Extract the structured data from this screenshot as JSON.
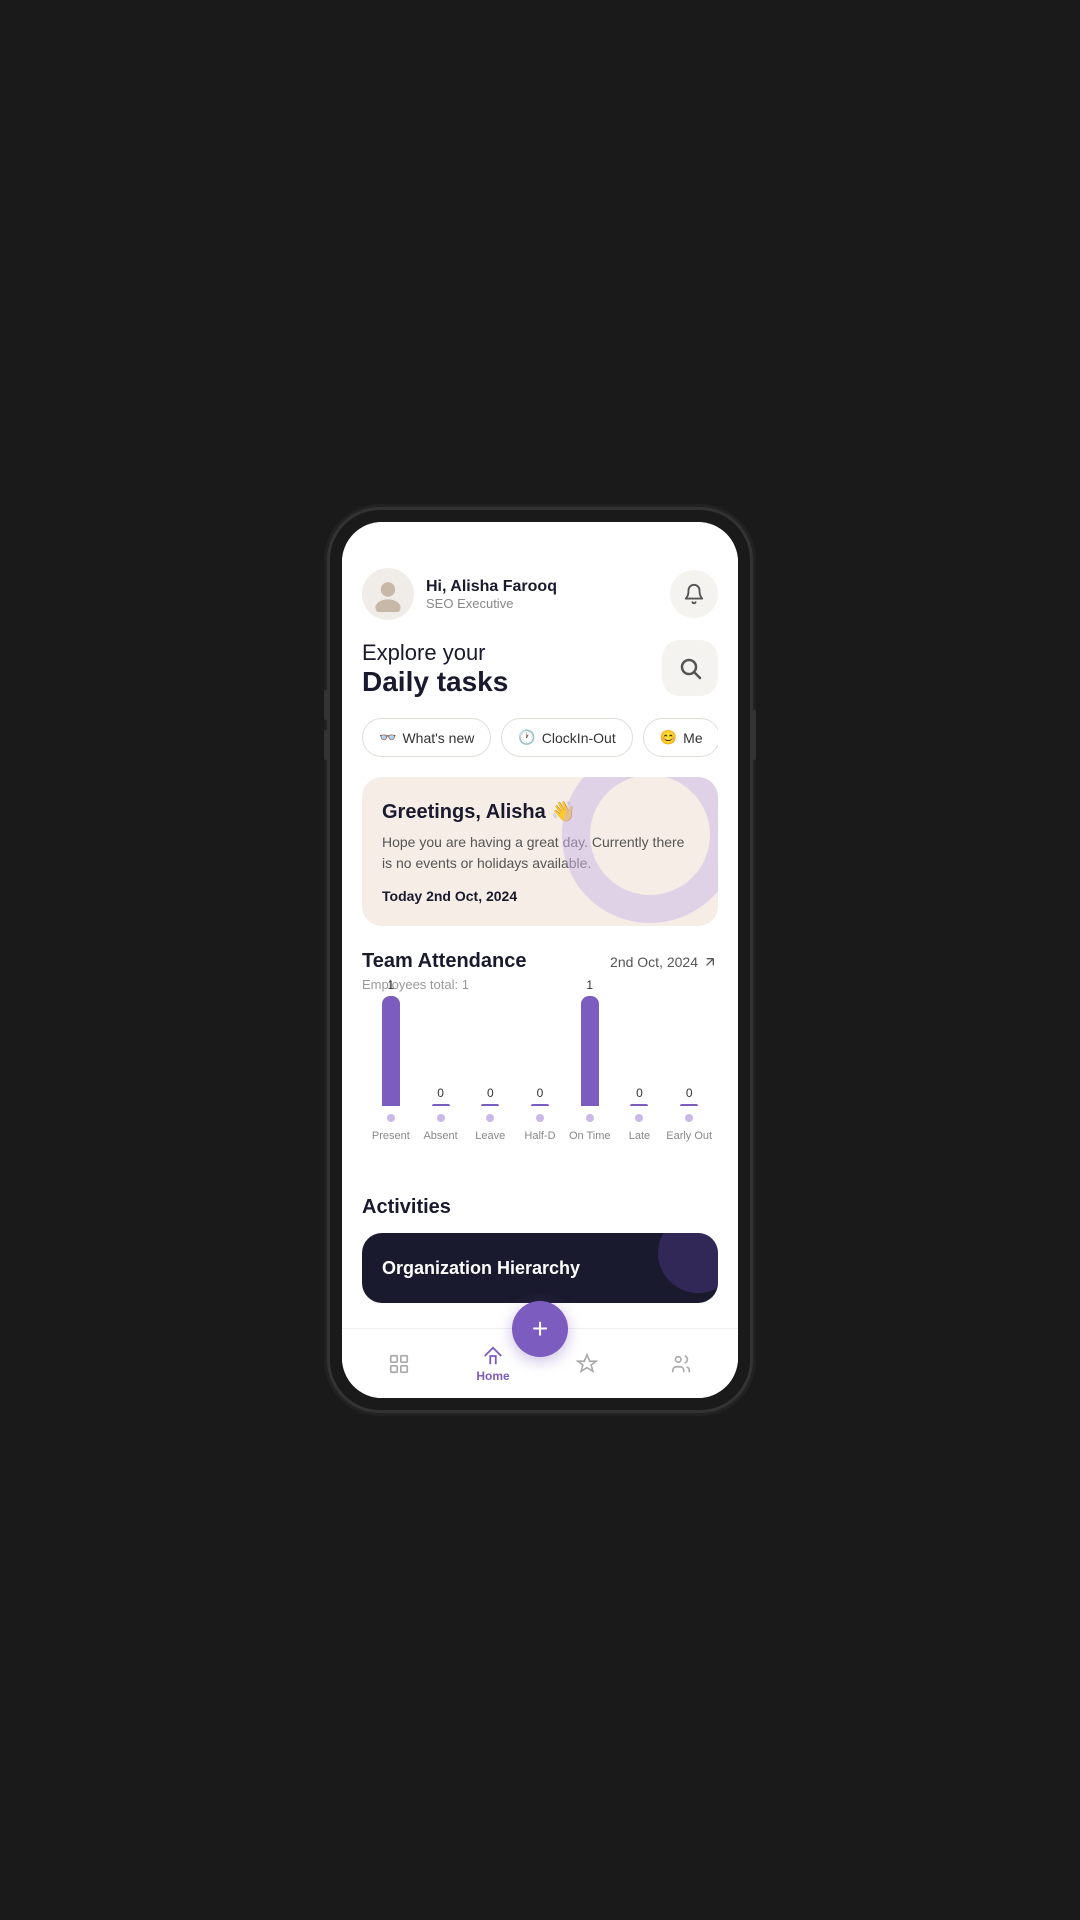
{
  "header": {
    "greeting": "Hi, Alisha Farooq",
    "role": "SEO Executive"
  },
  "hero": {
    "explore_label": "Explore your",
    "title": "Daily tasks"
  },
  "filter_tabs": [
    {
      "id": "whats-new",
      "icon": "👓",
      "label": "What's new"
    },
    {
      "id": "clockin-out",
      "icon": "🕐",
      "label": "ClockIn-Out"
    },
    {
      "id": "me",
      "icon": "😊",
      "label": "Me"
    }
  ],
  "greeting_card": {
    "title": "Greetings, Alisha 👋",
    "body": "Hope you are having a great day. Currently there is no events or holidays available.",
    "date": "Today 2nd Oct, 2024"
  },
  "team_attendance": {
    "section_title": "Team Attendance",
    "date": "2nd Oct, 2024",
    "employees_total": "Employees total: 1",
    "bars": [
      {
        "label": "Present",
        "value": "1",
        "height": 110
      },
      {
        "label": "Absent",
        "value": "0",
        "height": 0
      },
      {
        "label": "Leave",
        "value": "0",
        "height": 0
      },
      {
        "label": "Half-D",
        "value": "0",
        "height": 0
      },
      {
        "label": "On Time",
        "value": "1",
        "height": 110
      },
      {
        "label": "Late",
        "value": "0",
        "height": 0
      },
      {
        "label": "Early Out",
        "value": "0",
        "height": 0
      }
    ]
  },
  "activities": {
    "section_title": "Activities",
    "card_label": "Organization Hierarchy"
  },
  "bottom_nav": {
    "items": [
      {
        "id": "dashboard",
        "label": "",
        "active": false
      },
      {
        "id": "home",
        "label": "Home",
        "active": true
      },
      {
        "id": "badge",
        "label": "",
        "active": false
      },
      {
        "id": "team",
        "label": "",
        "active": false
      }
    ],
    "fab_label": "+"
  }
}
